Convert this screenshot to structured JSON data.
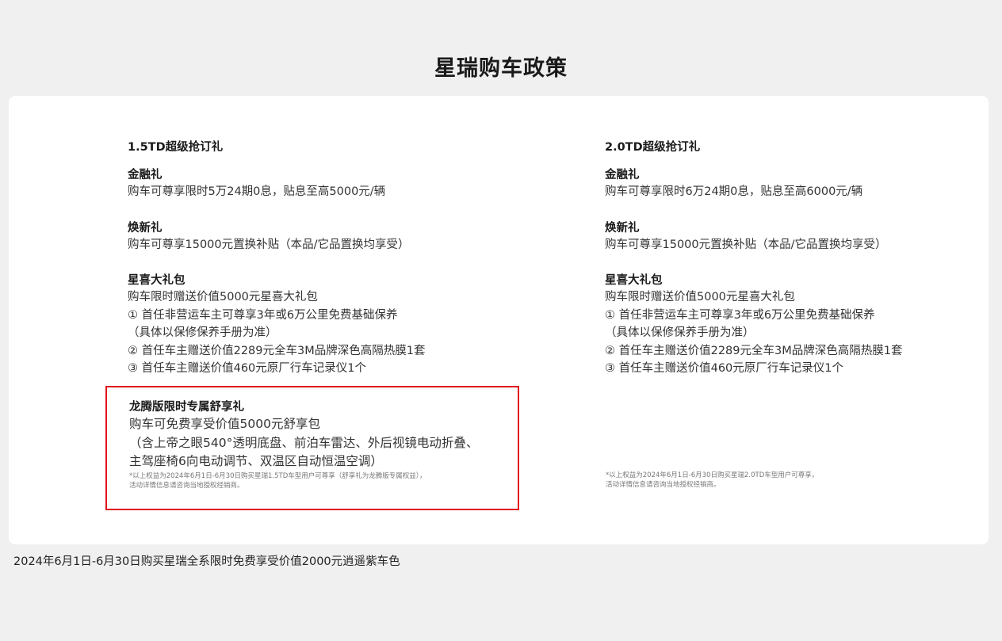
{
  "title": "星瑞购车政策",
  "left": {
    "heading": "1.5TD超级抢订礼",
    "finance": {
      "name": "金融礼",
      "lines": [
        "购车可尊享限时5万24期0息，贴息至高5000元/辆"
      ]
    },
    "renew": {
      "name": "焕新礼",
      "lines": [
        "购车可尊享15000元置换补贴（本品/它品置换均享受）"
      ]
    },
    "gift": {
      "name": "星喜大礼包",
      "lines": [
        "购车限时赠送价值5000元星喜大礼包",
        "① 首任非营运车主可尊享3年或6万公里免费基础保养",
        "（具体以保修保养手册为准）",
        "② 首任车主赠送价值2289元全车3M品牌深色高隔热膜1套",
        "③ 首任车主赠送价值460元原厂行车记录仪1个"
      ]
    },
    "special": {
      "name": "龙腾版限时专属舒享礼",
      "lines": [
        "购车可免费享受价值5000元舒享包",
        "（含上帝之眼540°透明底盘、前泊车雷达、外后视镜电动折叠、",
        "主驾座椅6向电动调节、双温区自动恒温空调）"
      ],
      "notes": [
        "*以上权益为2024年6月1日-6月30日购买星瑞1.5TD车型用户可尊享（舒享礼为龙腾版专属权益），",
        "活动详情信息请咨询当地授权经销商。"
      ]
    }
  },
  "right": {
    "heading": "2.0TD超级抢订礼",
    "finance": {
      "name": "金融礼",
      "lines": [
        "购车可尊享限时6万24期0息，贴息至高6000元/辆"
      ]
    },
    "renew": {
      "name": "焕新礼",
      "lines": [
        "购车可尊享15000元置换补贴（本品/它品置换均享受）"
      ]
    },
    "gift": {
      "name": "星喜大礼包",
      "lines": [
        "购车限时赠送价值5000元星喜大礼包",
        "① 首任非营运车主可尊享3年或6万公里免费基础保养",
        "（具体以保修保养手册为准）",
        "② 首任车主赠送价值2289元全车3M品牌深色高隔热膜1套",
        "③ 首任车主赠送价值460元原厂行车记录仪1个"
      ]
    },
    "notes": [
      "*以上权益为2024年6月1日-6月30日购买星瑞2.0TD车型用户可尊享，",
      "活动详情信息请咨询当地授权经销商。"
    ]
  },
  "bottom_note": "2024年6月1日-6月30日购买星瑞全系限时免费享受价值2000元逍遥紫车色",
  "colors": {
    "highlight_border": "#e0141e",
    "card_bg": "#ffffff",
    "page_bg": "#f0f0f0"
  }
}
